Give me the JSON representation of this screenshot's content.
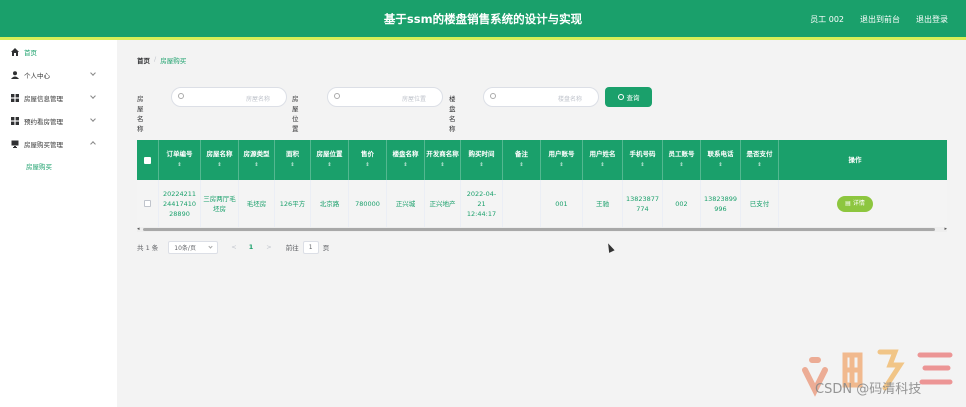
{
  "header": {
    "title": "基于ssm的楼盘销售系统的设计与实现",
    "user": "员工 002",
    "back_to_front": "退出到前台",
    "logout": "退出登录",
    "bg_color": "#1aa06b",
    "strip_color": "#d8ee58"
  },
  "sidebar": {
    "items": [
      {
        "label": "首页",
        "icon": "home-icon"
      },
      {
        "label": "个人中心",
        "icon": "user-icon"
      },
      {
        "label": "房屋信息管理",
        "icon": "grid-icon"
      },
      {
        "label": "预约看房管理",
        "icon": "grid-icon"
      },
      {
        "label": "房屋购买管理",
        "icon": "monitor-icon"
      }
    ],
    "sub_item": "房屋购买"
  },
  "breadcrumb": {
    "home": "首页",
    "separator": "/",
    "current": "房屋购买"
  },
  "search": {
    "house_name_label": "房屋名称",
    "house_name_placeholder": "房屋名称",
    "house_location_label": "房屋位置",
    "house_location_placeholder": "房屋位置",
    "building_name_label": "楼盘名称",
    "building_name_placeholder": "楼盘名称",
    "query_button": "查询"
  },
  "table": {
    "columns": [
      "订单编号",
      "房屋名称",
      "房源类型",
      "面积",
      "房屋位置",
      "售价",
      "楼盘名称",
      "开发商名称",
      "购买时间",
      "备注",
      "用户账号",
      "用户姓名",
      "手机号码",
      "员工账号",
      "联系电话",
      "是否支付",
      "操作"
    ],
    "rows": [
      {
        "order_no": "20224211244174102889​0",
        "house_name": "三房两厅毛坯房",
        "house_type": "毛坯房",
        "area": "126平方",
        "location": "北京路",
        "price": "780000",
        "building_name": "正兴城",
        "developer": "正兴地产",
        "purchase_time": "2022-04-21 12:44:17",
        "remark": "",
        "user_account": "001",
        "user_name": "王驰",
        "phone": "13823877774",
        "staff_account": "002",
        "contact_phone": "13823899996",
        "paid": "已支付",
        "action": "详情"
      }
    ],
    "accent": "#1aa06b",
    "button_color": "#8dc63f"
  },
  "pagination": {
    "total": "共 1 条",
    "page_size": "10条/页",
    "prev": "<",
    "current_page": "1",
    "next": ">",
    "goto_label": "前往",
    "goto_value": "1",
    "page_suffix": "页"
  },
  "watermark": "CSDN @码清科技"
}
